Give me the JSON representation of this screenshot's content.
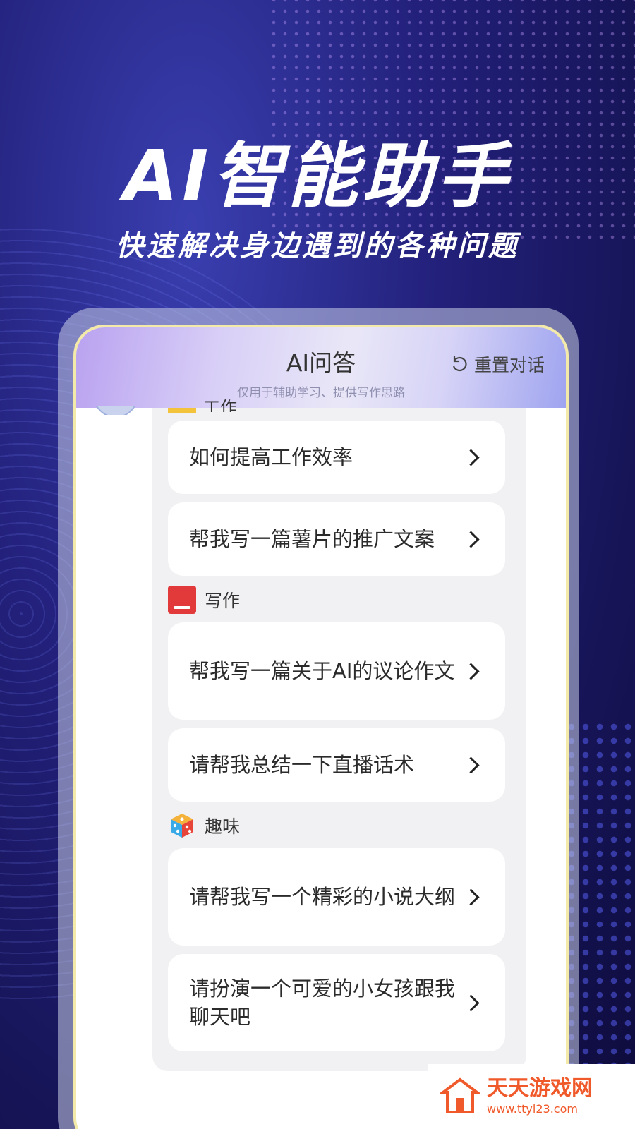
{
  "hero": {
    "title": "AI智能助手",
    "subtitle": "快速解决身边遇到的各种问题"
  },
  "header": {
    "title": "AI问答",
    "note": "仅用于辅助学习、提供写作思路",
    "reset_label": "重置对话"
  },
  "categories": [
    {
      "label": "工作",
      "icon": "folder-icon"
    },
    {
      "label": "写作",
      "icon": "book-icon"
    },
    {
      "label": "趣味",
      "icon": "dice-icon"
    }
  ],
  "questions": {
    "work": [
      "如何提高工作效率",
      "帮我写一篇薯片的推广文案"
    ],
    "writing": [
      "帮我写一篇关于AI的议论作文",
      "请帮我总结一下直播话术"
    ],
    "fun": [
      "请帮我写一个精彩的小说大纲",
      "请扮演一个可爱的小女孩跟我聊天吧"
    ]
  },
  "watermark": {
    "name": "天天游戏网",
    "url": "www.ttyl23.com"
  },
  "colors": {
    "accent_red": "#e2393a",
    "watermark_orange": "#f0592a",
    "frame_yellow": "#f3e9a8"
  }
}
